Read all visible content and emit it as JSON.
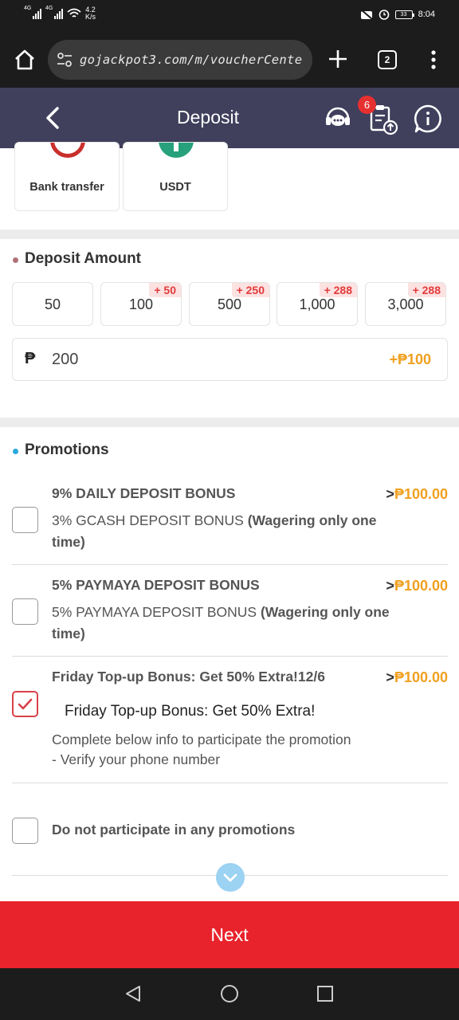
{
  "status_bar": {
    "net1": "4G",
    "net2": "4G",
    "speed_value": "4.2",
    "speed_unit": "K/s",
    "battery": "33",
    "time": "8:04"
  },
  "browser": {
    "url": "gojackpot3.com/m/voucherCente",
    "tab_count": "2"
  },
  "header": {
    "title": "Deposit",
    "records_badge": "6"
  },
  "payment_methods": [
    {
      "label": "Bank transfer"
    },
    {
      "label": "USDT"
    }
  ],
  "deposit_amount": {
    "title": "Deposit Amount",
    "presets": [
      {
        "value": "50",
        "bonus": ""
      },
      {
        "value": "100",
        "bonus": "+ 50"
      },
      {
        "value": "500",
        "bonus": "+ 250"
      },
      {
        "value": "1,000",
        "bonus": "+ 288"
      },
      {
        "value": "3,000",
        "bonus": "+ 288"
      }
    ],
    "currency_symbol": "₱",
    "input_value": "200",
    "input_bonus": "+₱100"
  },
  "promotions": {
    "title": "Promotions",
    "items": [
      {
        "title": "9% DAILY DEPOSIT BONUS",
        "amount_prefix": ">",
        "amount": "₱100.00",
        "desc_normal": "3% GCASH DEPOSIT BONUS ",
        "desc_bold": "(Wagering only one time)",
        "checked": false
      },
      {
        "title": "5% PAYMAYA DEPOSIT BONUS",
        "amount_prefix": ">",
        "amount": "₱100.00",
        "desc_normal": "5% PAYMAYA DEPOSIT BONUS ",
        "desc_bold": "(Wagering only one time)",
        "checked": false
      },
      {
        "title": "Friday Top-up Bonus: Get 50% Extra!12/6",
        "amount_prefix": ">",
        "amount": "₱100.00",
        "desc_headline": "Friday Top-up Bonus: Get 50% Extra!",
        "desc_line1": "Complete below info to participate the promotion",
        "desc_line2": "- Verify your phone number",
        "checked": true
      }
    ],
    "opt_out_label": "Do not participate in any promotions"
  },
  "footer": {
    "next_label": "Next"
  },
  "colors": {
    "header_bg": "#403f5c",
    "accent_red": "#e8232b",
    "bonus_orange": "#f0a020",
    "checkbox_red": "#d8424a"
  }
}
